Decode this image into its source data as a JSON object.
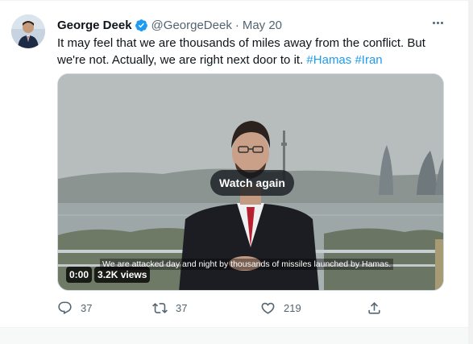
{
  "tweet": {
    "author_name": "George Deek",
    "handle": "@GeorgeDeek",
    "separator": "·",
    "date": "May 20",
    "text_main": "It may feel that we are thousands of miles away from the conflict. But we're not. Actually, we are right next door to it.",
    "hashtags": [
      "#Hamas",
      "#Iran"
    ]
  },
  "video": {
    "watch_again_label": "Watch again",
    "caption": "We are attacked day and night by thousands of missiles launched by Hamas.",
    "time": "0:00",
    "views": "3.2K views"
  },
  "actions": {
    "reply_count": "37",
    "retweet_count": "37",
    "like_count": "219"
  },
  "icons": {
    "verified": "verified-badge-icon",
    "more": "more-icon",
    "reply": "reply-icon",
    "retweet": "retweet-icon",
    "like": "heart-icon",
    "share": "share-icon"
  },
  "colors": {
    "accent": "#1d9bf0",
    "muted_text": "#536471",
    "primary_text": "#0f1419"
  }
}
